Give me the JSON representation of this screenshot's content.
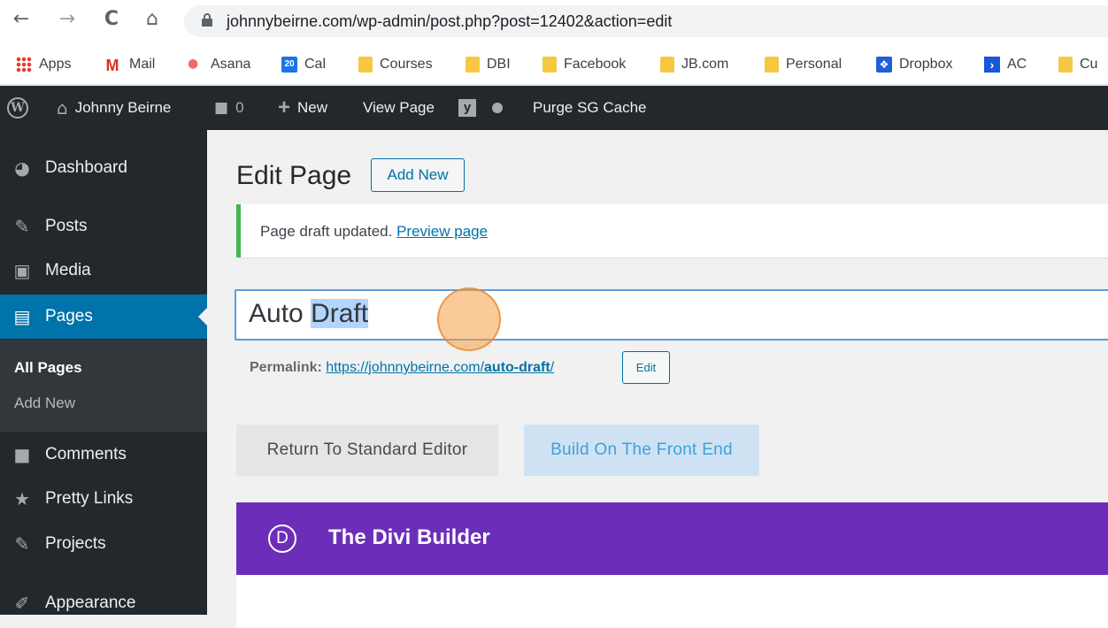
{
  "browser": {
    "nav": {
      "back": "←",
      "forward": "→",
      "reload": "C",
      "home": "⌂"
    },
    "url": "johnnybeirne.com/wp-admin/post.php?post=12402&action=edit",
    "bookmarks": [
      {
        "label": "Apps",
        "icon": "apps-grid-icon"
      },
      {
        "label": "Mail",
        "icon": "gmail-icon"
      },
      {
        "label": "Asana",
        "icon": "asana-icon"
      },
      {
        "label": "Cal",
        "icon": "calendar-icon",
        "badge": "20"
      },
      {
        "label": "Courses",
        "icon": "folder-icon"
      },
      {
        "label": "DBI",
        "icon": "folder-icon"
      },
      {
        "label": "Facebook",
        "icon": "folder-icon"
      },
      {
        "label": "JB.com",
        "icon": "folder-icon"
      },
      {
        "label": "Personal",
        "icon": "folder-icon"
      },
      {
        "label": "Dropbox",
        "icon": "dropbox-icon"
      },
      {
        "label": "AC",
        "icon": "activecampaign-icon"
      },
      {
        "label": "Cu",
        "icon": "folder-icon"
      }
    ]
  },
  "adminbar": {
    "site_name": "Johnny Beirne",
    "comments_count": "0",
    "new_label": "New",
    "view_page": "View Page",
    "purge": "Purge SG Cache"
  },
  "sidebar": {
    "items": [
      {
        "label": "Dashboard",
        "icon": "dashboard-icon"
      },
      {
        "label": "Posts",
        "icon": "pin-icon"
      },
      {
        "label": "Media",
        "icon": "media-icon"
      },
      {
        "label": "Pages",
        "icon": "pages-icon",
        "active": true
      },
      {
        "label": "Comments",
        "icon": "comment-icon"
      },
      {
        "label": "Pretty Links",
        "icon": "star-icon"
      },
      {
        "label": "Projects",
        "icon": "pin-icon"
      },
      {
        "label": "Appearance",
        "icon": "brush-icon"
      }
    ],
    "submenu": [
      "All Pages",
      "Add New"
    ]
  },
  "main": {
    "heading": "Edit Page",
    "add_new": "Add New",
    "notice": {
      "text": "Page draft updated.",
      "link": "Preview page"
    },
    "title": {
      "plain": "Auto ",
      "selected": "Draft"
    },
    "permalink": {
      "label": "Permalink:",
      "url_base": "https://johnnybeirne.com/",
      "slug": "auto-draft",
      "trail": "/",
      "edit": "Edit"
    },
    "buttons": {
      "standard_editor": "Return To Standard Editor",
      "front_end": "Build On The Front End"
    },
    "divi": {
      "logo": "D",
      "title": "The Divi Builder"
    }
  },
  "colors": {
    "adminbar_bg": "#23282d",
    "accent": "#0073aa",
    "notice_border": "#46b450",
    "divi_purple": "#6c2eb9"
  }
}
